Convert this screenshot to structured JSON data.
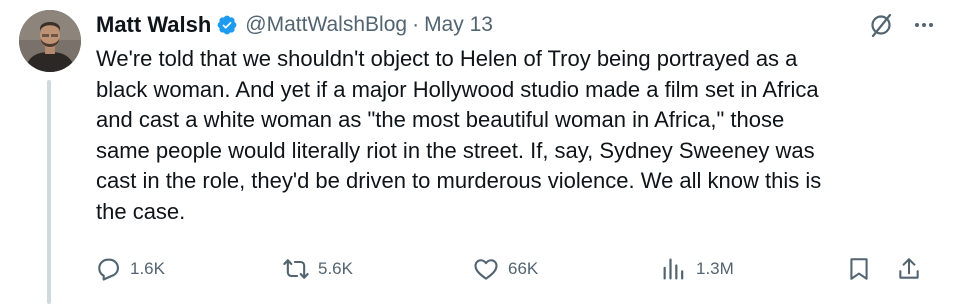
{
  "author": {
    "name": "Matt Walsh",
    "handle": "@MattWalshBlog",
    "separator": "·",
    "date": "May 13"
  },
  "tweet": {
    "lines": [
      "We're told that we shouldn't object to Helen of Troy being portrayed as a",
      "black woman. And yet if a major Hollywood studio made a film set in Africa",
      "and cast a white woman as \"the most beautiful woman in Africa,\" those",
      "same people would literally riot in the street. If, say, Sydney Sweeney was",
      "cast in the role, they'd be driven to murderous violence. We all know this is",
      "the case."
    ]
  },
  "actions": {
    "replies": "1.6K",
    "reposts": "5.6K",
    "likes": "66K",
    "views": "1.3M"
  },
  "icons": [
    "verified-badge-icon",
    "grok-slash-icon",
    "more-icon",
    "reply-icon",
    "repost-icon",
    "like-icon",
    "views-icon",
    "bookmark-icon",
    "share-icon"
  ],
  "colors": {
    "text": "#0f1419",
    "muted": "#536471",
    "verified": "#1d9bf0",
    "thread_line": "#cfd9de"
  }
}
